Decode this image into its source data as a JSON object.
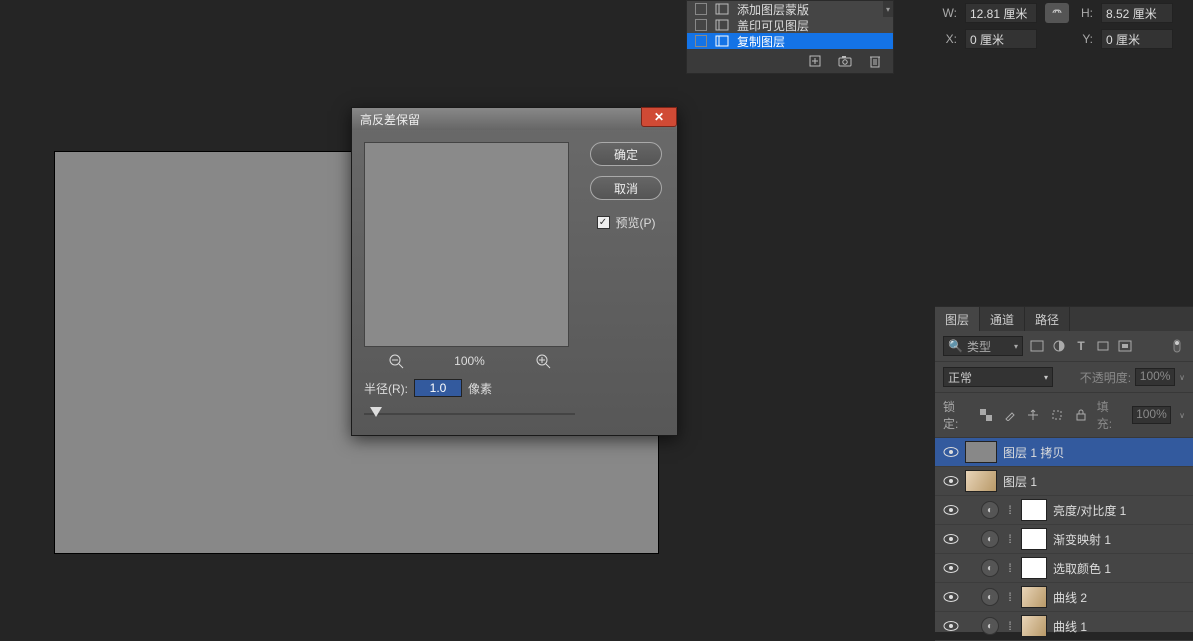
{
  "properties": {
    "w_label": "W:",
    "w_value": "12.81 厘米",
    "h_label": "H:",
    "h_value": "8.52 厘米",
    "x_label": "X:",
    "x_value": "0 厘米",
    "y_label": "Y:",
    "y_value": "0 厘米"
  },
  "history": {
    "items": [
      {
        "label": "添加图层蒙版",
        "selected": false
      },
      {
        "label": "盖印可见图层",
        "selected": false
      },
      {
        "label": "复制图层",
        "selected": true
      }
    ]
  },
  "dialog": {
    "title": "高反差保留",
    "ok": "确定",
    "cancel": "取消",
    "preview_label": "预览(P)",
    "zoom": "100%",
    "radius_label": "半径(R):",
    "radius_value": "1.0",
    "radius_unit": "像素"
  },
  "layers_panel": {
    "tabs": {
      "layers": "图层",
      "channels": "通道",
      "paths": "路径"
    },
    "filter_placeholder": "类型",
    "blend_mode": "正常",
    "opacity_label": "不透明度:",
    "opacity_value": "100%",
    "lock_label": "锁定:",
    "fill_label": "填充:",
    "fill_value": "100%",
    "layers": [
      {
        "name": "图层 1 拷贝",
        "type": "raster",
        "thumb": "gray",
        "selected": true
      },
      {
        "name": "图层 1",
        "type": "raster",
        "thumb": "photo",
        "selected": false
      },
      {
        "name": "亮度/对比度 1",
        "type": "adjustment",
        "selected": false
      },
      {
        "name": "渐变映射 1",
        "type": "adjustment",
        "selected": false
      },
      {
        "name": "选取颜色 1",
        "type": "adjustment",
        "selected": false
      },
      {
        "name": "曲线 2",
        "type": "adjustment-thumb",
        "selected": false
      },
      {
        "name": "曲线 1",
        "type": "adjustment-thumb",
        "selected": false
      }
    ]
  }
}
